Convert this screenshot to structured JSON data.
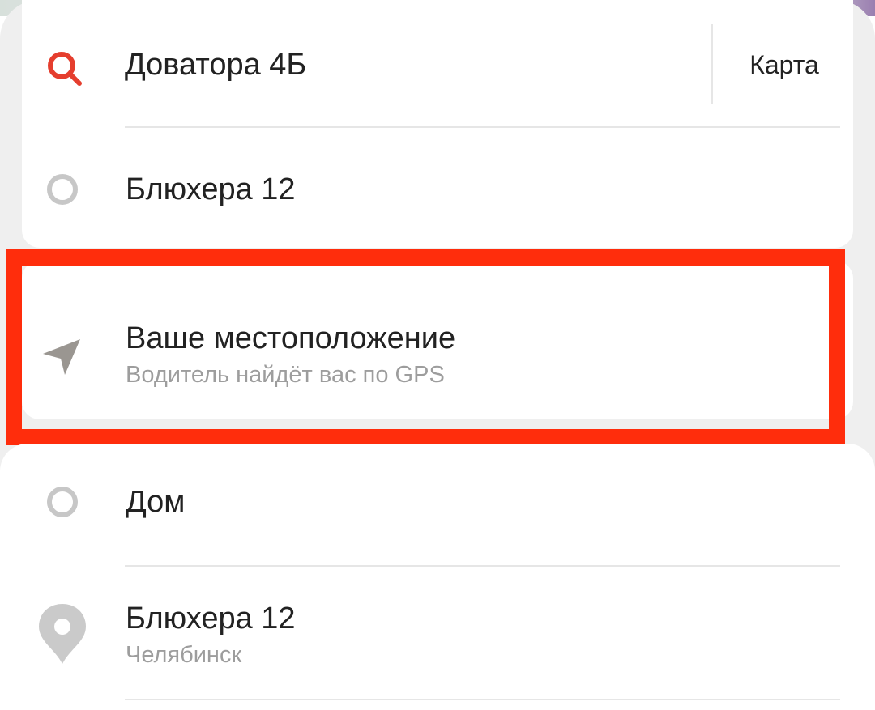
{
  "search": {
    "value": "Доватора 4Б",
    "map_button": "Карта"
  },
  "route": {
    "destination": "Блюхера 12"
  },
  "location_option": {
    "title": "Ваше местоположение",
    "subtitle": "Водитель найдёт вас по GPS",
    "icon": "navigation-arrow-icon"
  },
  "suggestions": [
    {
      "title": "Дом",
      "subtitle": "",
      "icon": "circle-icon"
    },
    {
      "title": "Блюхера 12",
      "subtitle": "Челябинск",
      "icon": "map-pin-icon"
    }
  ],
  "colors": {
    "accent": "#E53E2E",
    "highlight": "#FF2D0C",
    "icon_gray": "#C7C7C7",
    "arrow_gray": "#9A9691",
    "subtitle": "#9D9D9D"
  }
}
